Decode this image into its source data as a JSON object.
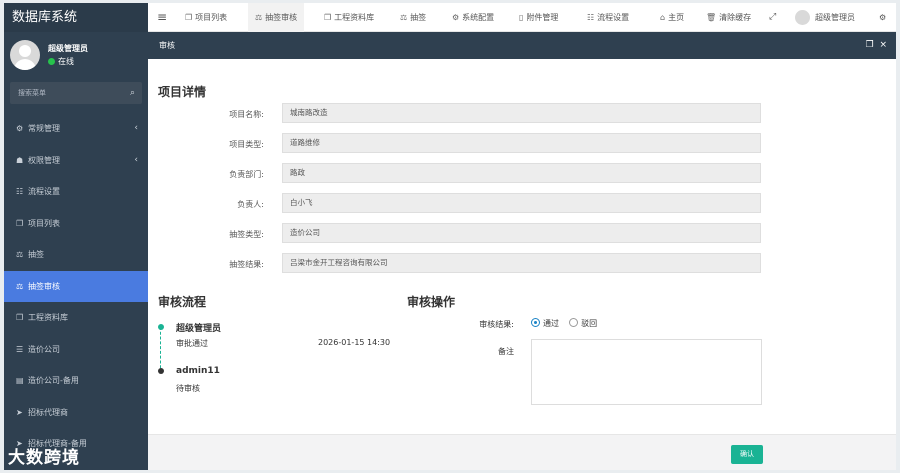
{
  "app": {
    "title": "数据库系统"
  },
  "user": {
    "name": "超级管理员",
    "status": "在线"
  },
  "sidebar": {
    "search_placeholder": "搜索菜单",
    "items": [
      {
        "icon": "cogs-icon",
        "glyph": "⚙",
        "label": "常规管理",
        "has_arrow": true
      },
      {
        "icon": "users-icon",
        "glyph": "☗",
        "label": "权限管理",
        "has_arrow": true
      },
      {
        "icon": "sitemap-icon",
        "glyph": "☷",
        "label": "流程设置"
      },
      {
        "icon": "copy-icon",
        "glyph": "❐",
        "label": "项目列表"
      },
      {
        "icon": "gavel-icon",
        "glyph": "⚖",
        "label": "抽签"
      },
      {
        "icon": "gavel-icon",
        "glyph": "⚖",
        "label": "抽签审核",
        "active": true
      },
      {
        "icon": "files-icon",
        "glyph": "❒",
        "label": "工程资料库"
      },
      {
        "icon": "list-icon",
        "glyph": "☰",
        "label": "造价公司"
      },
      {
        "icon": "list-alt-icon",
        "glyph": "▤",
        "label": "造价公司-备用"
      },
      {
        "icon": "send-icon",
        "glyph": "➤",
        "label": "招标代理商"
      },
      {
        "icon": "send-icon",
        "glyph": "➤",
        "label": "招标代理商-备用"
      }
    ]
  },
  "watermark": "大数跨境",
  "topbar": {
    "menu_toggle": "≡",
    "tabs": [
      "项目列表",
      "抽签审核",
      "工程资料库",
      "抽签",
      "系统配置",
      "附件管理",
      "流程设置"
    ],
    "actions": {
      "home": "主页",
      "clear_cache": "清除缓存"
    },
    "user": "超级管理员"
  },
  "panel": {
    "title": "审核"
  },
  "details": {
    "heading": "项目详情",
    "fields": [
      {
        "label": "项目名称:",
        "value": "城南路改造"
      },
      {
        "label": "项目类型:",
        "value": "道路维修"
      },
      {
        "label": "负责部门:",
        "value": "路政"
      },
      {
        "label": "负责人:",
        "value": "白小飞"
      },
      {
        "label": "抽签类型:",
        "value": "造价公司"
      },
      {
        "label": "抽签结果:",
        "value": "吕梁市金开工程咨询有限公司"
      }
    ]
  },
  "flow": {
    "heading": "审核流程",
    "steps": [
      {
        "name": "超级管理员",
        "status": "审批通过",
        "time": "2026-01-15 14:30",
        "color": "#1ab394"
      },
      {
        "name": "admin11",
        "status": "待审核",
        "time": "",
        "color": "#333333"
      }
    ]
  },
  "operation": {
    "heading": "审核操作",
    "result_label": "审核结果:",
    "options": [
      "通过",
      "驳回"
    ],
    "selected": "通过",
    "remark_label": "备注",
    "remark_value": ""
  },
  "footer": {
    "confirm_label": "确认"
  },
  "colors": {
    "sidebar": "#2f4050",
    "active": "#4a7be0",
    "primary": "#1ab394",
    "online": "#27c24c"
  }
}
